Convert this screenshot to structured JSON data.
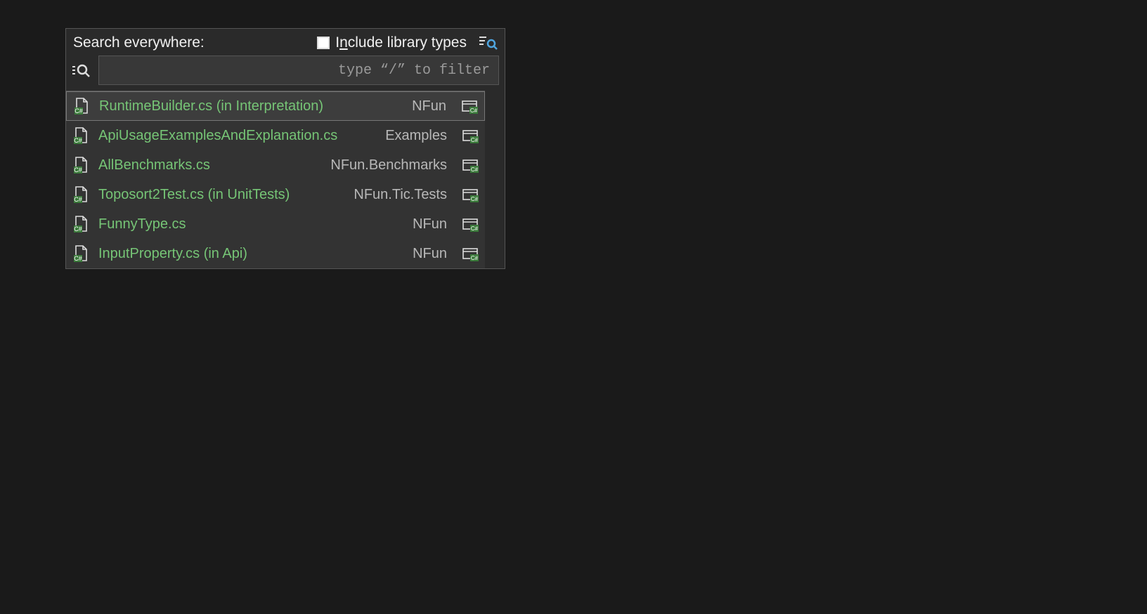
{
  "header": {
    "title": "Search everywhere:",
    "include_label_pre": "I",
    "include_label_underline": "n",
    "include_label_post": "clude library types"
  },
  "search": {
    "placeholder": "type “/” to filter",
    "value": ""
  },
  "results": [
    {
      "file": "RuntimeBuilder.cs (in Interpretation)",
      "project": "NFun",
      "selected": true
    },
    {
      "file": "ApiUsageExamplesAndExplanation.cs",
      "project": "Examples",
      "selected": false
    },
    {
      "file": "AllBenchmarks.cs",
      "project": "NFun.Benchmarks",
      "selected": false
    },
    {
      "file": "Toposort2Test.cs (in UnitTests)",
      "project": "NFun.Tic.Tests",
      "selected": false
    },
    {
      "file": "FunnyType.cs",
      "project": "NFun",
      "selected": false
    },
    {
      "file": "InputProperty.cs (in Api)",
      "project": "NFun",
      "selected": false
    }
  ]
}
